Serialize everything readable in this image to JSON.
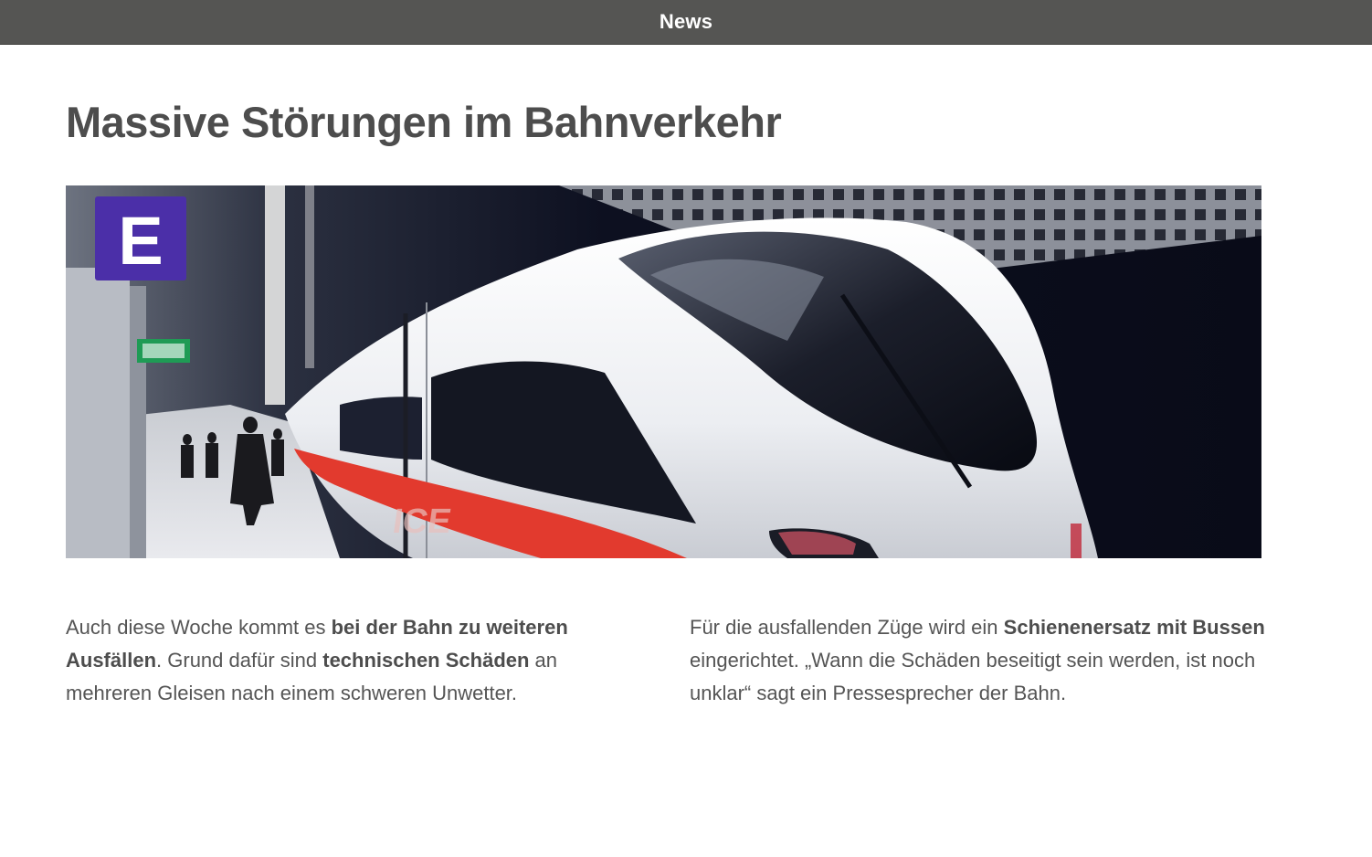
{
  "header": {
    "title": "News"
  },
  "article": {
    "headline": "Massive Störungen im Bahnverkehr",
    "image": {
      "alt": "High-speed train at an underground station platform",
      "platform_sign": "E",
      "train_livery": "ICE"
    },
    "columns": [
      {
        "t1": "Auch diese Woche kommt es ",
        "b1": "bei der Bahn zu weiteren Ausfällen",
        "t2": ". Grund dafür sind ",
        "b2": "technischen Schäden",
        "t3": " an mehreren Gleisen nach einem schweren Unwetter."
      },
      {
        "t1": "Für die ausfallenden Züge wird ein ",
        "b1": "Schienenersatz mit Bussen",
        "t2": " eingerichtet. „Wann die Schäden beseitigt sein werden, ist noch unklar“ sagt ein Pressesprecher der Bahn."
      }
    ]
  },
  "colors": {
    "topbar_bg": "#555553",
    "text": "#555555",
    "headline": "#4d4d4d",
    "train_stripe": "#e23a2e",
    "sign_blue": "#4b2fa8"
  }
}
